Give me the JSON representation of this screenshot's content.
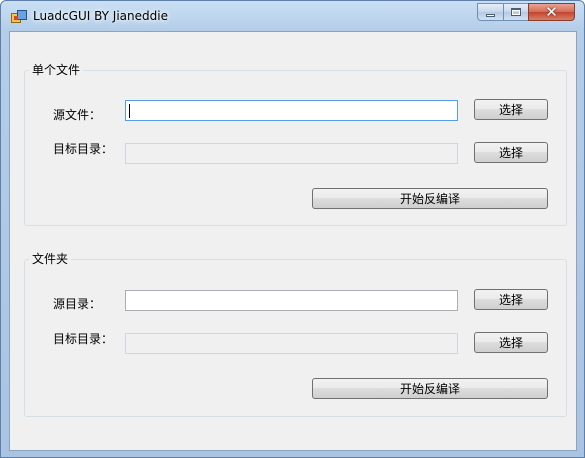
{
  "window": {
    "title": "LuadcGUI BY Jianeddie",
    "controls": {
      "minimize_icon": "minimize-icon",
      "maximize_icon": "maximize-icon",
      "close_icon": "close-icon",
      "close_glyph": "✕"
    }
  },
  "single_file_group": {
    "title": "单个文件",
    "source_label": "源文件：",
    "source_value": "",
    "target_label": "目标目录：",
    "target_value": "",
    "select_source_label": "选择",
    "select_target_label": "选择",
    "start_label": "开始反编译"
  },
  "folder_group": {
    "title": "文件夹",
    "source_label": "源目录：",
    "source_value": "",
    "target_label": "目标目录：",
    "target_value": "",
    "select_source_label": "选择",
    "select_target_label": "选择",
    "start_label": "开始反编译"
  },
  "colors": {
    "title_bar": "#b4cde8",
    "client_bg": "#f0f0f0",
    "close_button": "#c2452c"
  }
}
